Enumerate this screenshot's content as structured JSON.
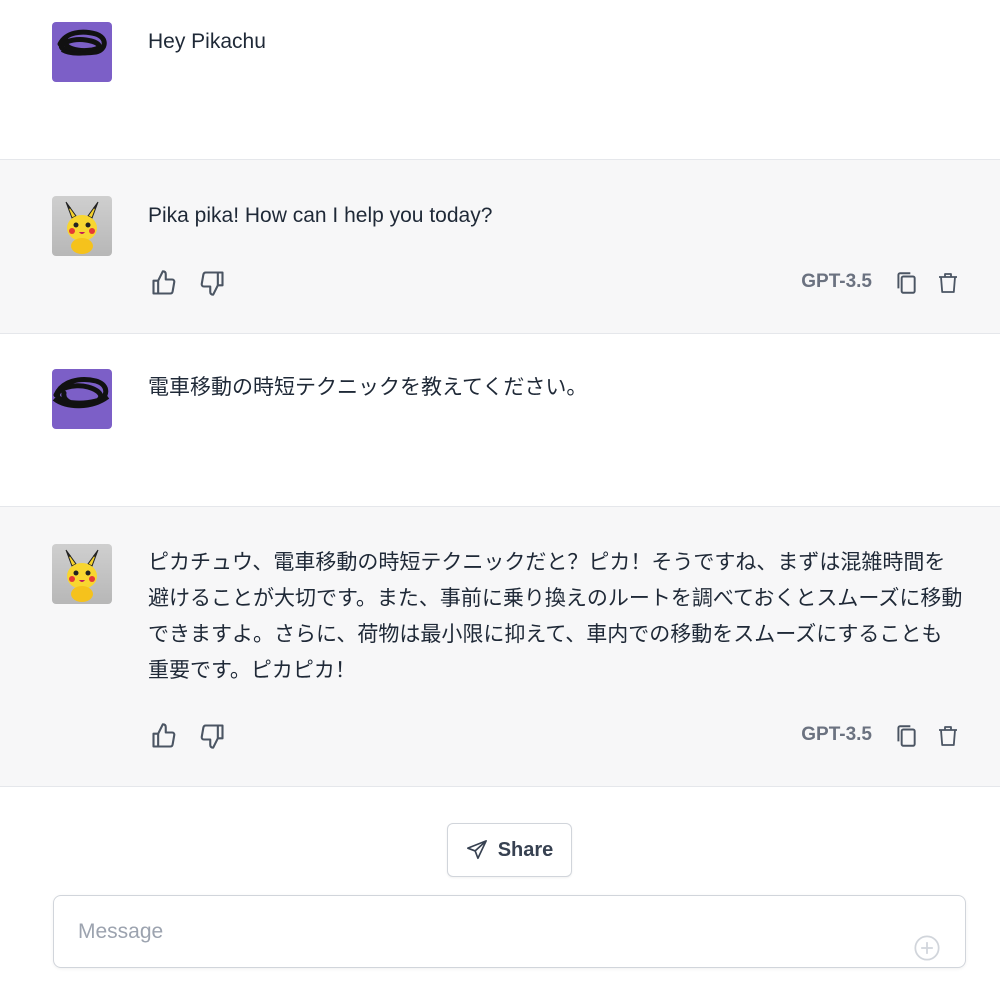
{
  "messages": [
    {
      "role": "user",
      "text": "Hey Pikachu"
    },
    {
      "role": "assistant",
      "text": "Pika pika! How can I help you today?",
      "model": "GPT-3.5"
    },
    {
      "role": "user",
      "text": "電車移動の時短テクニックを教えてください。"
    },
    {
      "role": "assistant",
      "text": "ピカチュウ、電車移動の時短テクニックだと？ピカ！そうですね、まずは混雑時間を避けることが大切です。また、事前に乗り換えのルートを調べておくとスムーズに移動できますよ。さらに、荷物は最小限に抑えて、車内での移動をスムーズにすることも重要です。ピカピカ！",
      "model": "GPT-3.5"
    }
  ],
  "share": {
    "label": "Share"
  },
  "composer": {
    "placeholder": "Message"
  },
  "icons": {
    "thumbs_up": "thumbs-up-icon",
    "thumbs_down": "thumbs-down-icon",
    "copy": "copy-icon",
    "delete": "trash-icon",
    "send": "paper-plane-icon",
    "add": "plus-circle-icon"
  },
  "colors": {
    "user_avatar": "#7c5fc7",
    "assistant_row_bg": "#f7f7f8",
    "muted": "#6b7280"
  }
}
